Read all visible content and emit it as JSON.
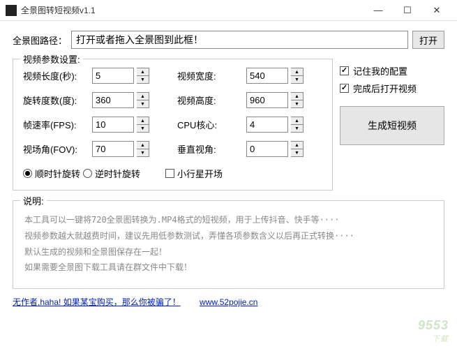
{
  "window": {
    "title": "全景图转短视频v1.1",
    "minimize": "—",
    "maximize": "☐",
    "close": "✕"
  },
  "path": {
    "label": "全景图路径：",
    "value": "打开或者拖入全景图到此框！",
    "open_btn": "打开"
  },
  "params": {
    "legend": "视频参数设置:",
    "left": [
      {
        "label": "视频长度(秒):",
        "value": "5"
      },
      {
        "label": "旋转度数(度):",
        "value": "360"
      },
      {
        "label": "帧速率(FPS):",
        "value": "10"
      },
      {
        "label": "视场角(FOV):",
        "value": "70"
      }
    ],
    "right": [
      {
        "label": "视频宽度:",
        "value": "540"
      },
      {
        "label": "视频高度:",
        "value": "960"
      },
      {
        "label": "CPU核心:",
        "value": "4"
      },
      {
        "label": "垂直视角:",
        "value": "0"
      }
    ],
    "rotation_cw": "顺时针旋转",
    "rotation_ccw": "逆时针旋转",
    "planet_open": "小行星开场"
  },
  "right": {
    "remember": "记住我的配置",
    "open_after": "完成后打开视频",
    "generate": "生成短视频"
  },
  "desc": {
    "legend": "说明:",
    "line1": "本工具可以一键将720全景图转换为.MP4格式的短视频，用于上传抖音、快手等····",
    "line2": "视频参数越大就越费时间，建议先用低参数测试，弄懂各项参数含义以后再正式转换····",
    "line3": "默认生成的视频和全景图保存在一起！",
    "line4": "如果需要全景图下载工具请在群文件中下载！"
  },
  "footer": {
    "author_link": "无作者,haha! 如果某宝购买，那么你被骗了！",
    "site_link": "www.52pojie.cn"
  },
  "watermark": {
    "main": "9553",
    "sub": "下载"
  }
}
